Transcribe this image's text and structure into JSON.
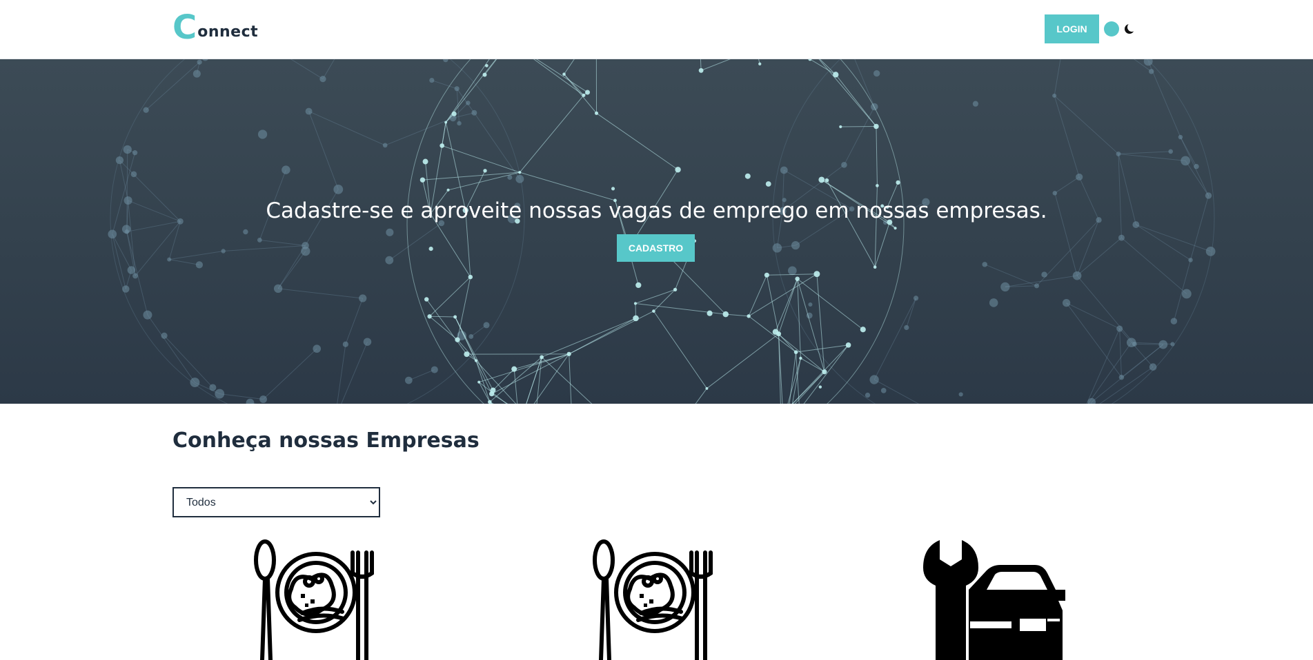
{
  "header": {
    "logo_initial": "C",
    "logo_rest": "onnect",
    "login_label": "LOGIN",
    "theme_toggle_icon": "moon-icon"
  },
  "hero": {
    "title": "Cadastre-se e aproveite nossas vagas de emprego em nossas empresas.",
    "cta_label": "CADASTRO",
    "background_icon": "network-globe"
  },
  "companies": {
    "title": "Conheça nossas Empresas",
    "filter": {
      "selected": "Todos"
    },
    "items": [
      {
        "icon": "restaurant-icon"
      },
      {
        "icon": "restaurant-icon"
      },
      {
        "icon": "car-repair-icon"
      }
    ]
  },
  "colors": {
    "accent": "#57c7c9",
    "dark": "#1f2d3d",
    "hero_bg": "#33414d"
  }
}
